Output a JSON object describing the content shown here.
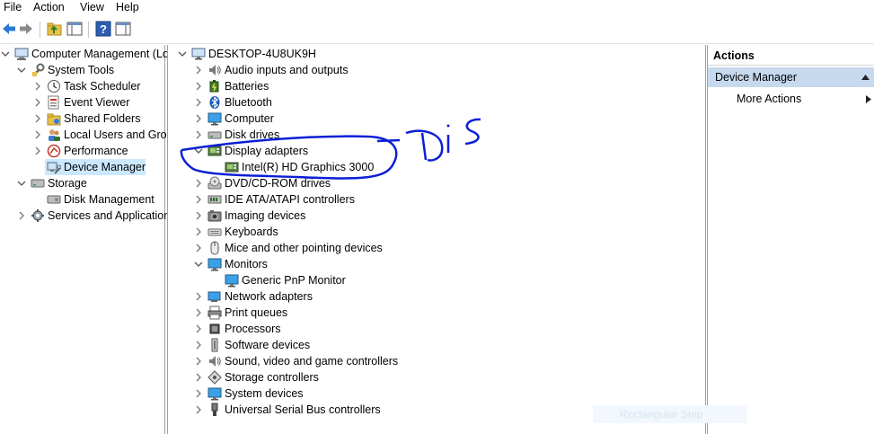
{
  "menu": [
    "File",
    "Action",
    "View",
    "Help"
  ],
  "toolbar": {
    "icons": [
      "back-icon",
      "forward-icon",
      "up-folder-icon",
      "show-hide-tree-icon",
      "help-icon",
      "properties-icon"
    ]
  },
  "left_tree": [
    {
      "label": "Computer Management (Local",
      "icon": "computer-management-icon",
      "expander": "down",
      "selected": false
    },
    {
      "label": "System Tools",
      "icon": "system-tools-icon",
      "expander": "down",
      "selected": false
    },
    {
      "label": "Task Scheduler",
      "icon": "task-scheduler-icon",
      "expander": "right",
      "selected": false
    },
    {
      "label": "Event Viewer",
      "icon": "event-viewer-icon",
      "expander": "right",
      "selected": false
    },
    {
      "label": "Shared Folders",
      "icon": "shared-folders-icon",
      "expander": "right",
      "selected": false
    },
    {
      "label": "Local Users and Groups",
      "icon": "users-icon",
      "expander": "right",
      "selected": false
    },
    {
      "label": "Performance",
      "icon": "performance-icon",
      "expander": "right",
      "selected": false
    },
    {
      "label": "Device Manager",
      "icon": "device-manager-icon",
      "expander": "",
      "selected": true
    },
    {
      "label": "Storage",
      "icon": "storage-icon",
      "expander": "down",
      "selected": false
    },
    {
      "label": "Disk Management",
      "icon": "disk-management-icon",
      "expander": "",
      "selected": false
    },
    {
      "label": "Services and Applications",
      "icon": "services-icon",
      "expander": "right",
      "selected": false
    }
  ],
  "device_tree": [
    {
      "label": "DESKTOP-4U8UK9H",
      "icon": "desktop-computer-icon",
      "expander": "down"
    },
    {
      "label": "Audio inputs and outputs",
      "icon": "speaker-icon",
      "expander": "right"
    },
    {
      "label": "Batteries",
      "icon": "battery-icon",
      "expander": "right"
    },
    {
      "label": "Bluetooth",
      "icon": "bluetooth-icon",
      "expander": "right"
    },
    {
      "label": "Computer",
      "icon": "monitor-icon",
      "expander": "right"
    },
    {
      "label": "Disk drives",
      "icon": "disk-drive-icon",
      "expander": "right"
    },
    {
      "label": "Display adapters",
      "icon": "display-adapter-icon",
      "expander": "down"
    },
    {
      "label": "Intel(R) HD Graphics 3000",
      "icon": "display-adapter-icon",
      "expander": ""
    },
    {
      "label": "DVD/CD-ROM drives",
      "icon": "dvd-drive-icon",
      "expander": "right"
    },
    {
      "label": "IDE ATA/ATAPI controllers",
      "icon": "ide-controller-icon",
      "expander": "right"
    },
    {
      "label": "Imaging devices",
      "icon": "camera-icon",
      "expander": "right"
    },
    {
      "label": "Keyboards",
      "icon": "keyboard-icon",
      "expander": "right"
    },
    {
      "label": "Mice and other pointing devices",
      "icon": "mouse-icon",
      "expander": "right"
    },
    {
      "label": "Monitors",
      "icon": "monitor-icon",
      "expander": "down"
    },
    {
      "label": "Generic PnP Monitor",
      "icon": "monitor-icon",
      "expander": ""
    },
    {
      "label": "Network adapters",
      "icon": "network-adapter-icon",
      "expander": "right"
    },
    {
      "label": "Print queues",
      "icon": "printer-icon",
      "expander": "right"
    },
    {
      "label": "Processors",
      "icon": "processor-icon",
      "expander": "right"
    },
    {
      "label": "Software devices",
      "icon": "software-device-icon",
      "expander": "right"
    },
    {
      "label": "Sound, video and game controllers",
      "icon": "speaker-icon",
      "expander": "right"
    },
    {
      "label": "Storage controllers",
      "icon": "storage-controller-icon",
      "expander": "right"
    },
    {
      "label": "System devices",
      "icon": "monitor-icon",
      "expander": "right"
    },
    {
      "label": "Universal Serial Bus controllers",
      "icon": "usb-icon",
      "expander": "right"
    }
  ],
  "actions": {
    "title": "Actions",
    "section": "Device Manager",
    "more_actions": "More Actions"
  },
  "snip_tooltip": "Rectangular Snip",
  "annotation": {
    "text": "Dis",
    "color": "#0b1fd6"
  },
  "colors": {
    "selection": "#cce8ff",
    "actions_section": "#c6d9ee"
  }
}
